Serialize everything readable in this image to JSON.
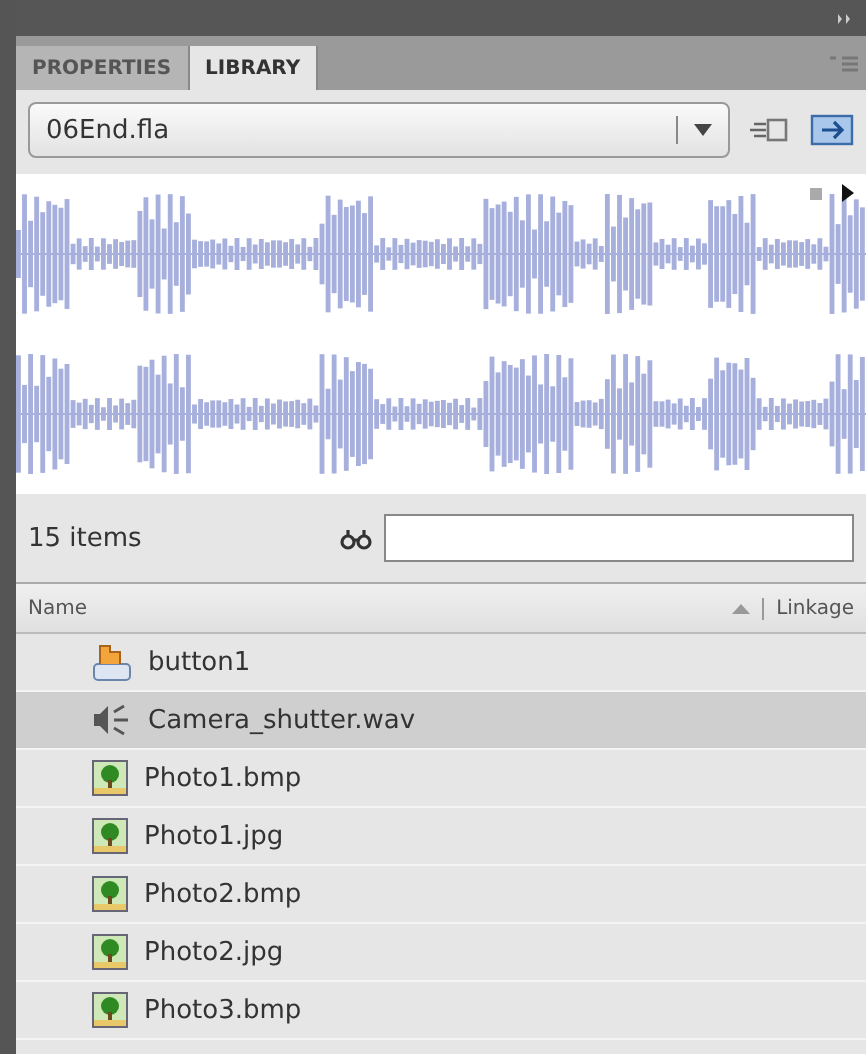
{
  "tabs": [
    {
      "label": "PROPERTIES",
      "selected": false
    },
    {
      "label": "LIBRARY",
      "selected": true
    }
  ],
  "document_select": {
    "value": "06End.fla"
  },
  "preview": {
    "kind": "waveform"
  },
  "item_count": "15 items",
  "columns": [
    "Name",
    "Linkage"
  ],
  "items": [
    {
      "name": "button1",
      "kind": "symbol",
      "selected": false
    },
    {
      "name": "Camera_shutter.wav",
      "kind": "sound",
      "selected": true
    },
    {
      "name": "Photo1.bmp",
      "kind": "bitmap",
      "selected": false
    },
    {
      "name": "Photo1.jpg",
      "kind": "bitmap",
      "selected": false
    },
    {
      "name": "Photo2.bmp",
      "kind": "bitmap",
      "selected": false
    },
    {
      "name": "Photo2.jpg",
      "kind": "bitmap",
      "selected": false
    },
    {
      "name": "Photo3.bmp",
      "kind": "bitmap",
      "selected": false
    }
  ]
}
